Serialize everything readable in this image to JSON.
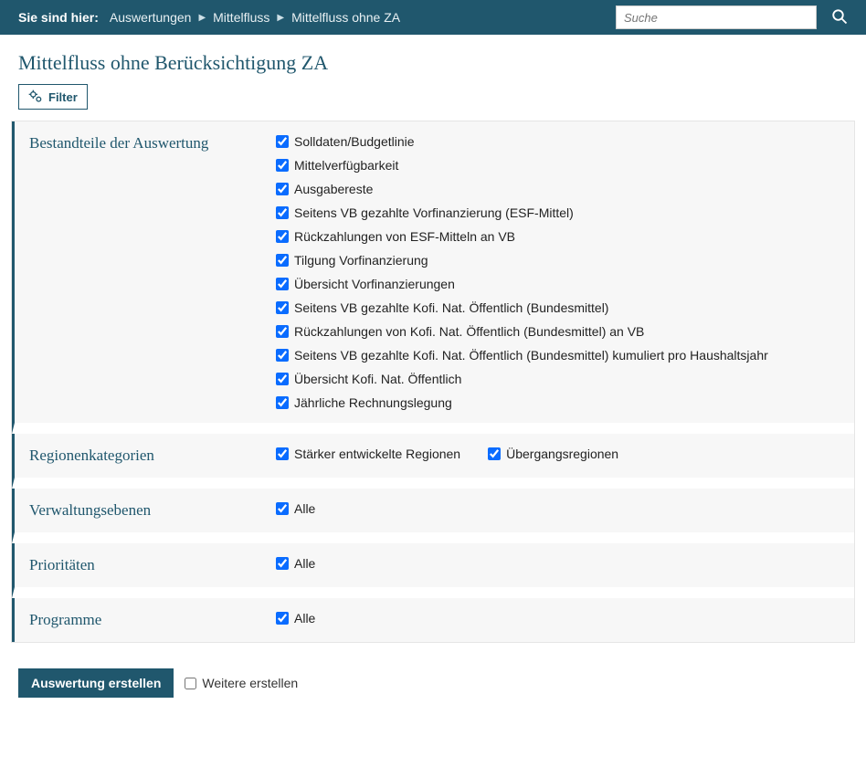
{
  "breadcrumb": {
    "label": "Sie sind hier:",
    "items": [
      "Auswertungen",
      "Mittelfluss",
      "Mittelfluss ohne ZA"
    ]
  },
  "search": {
    "placeholder": "Suche"
  },
  "page_title": "Mittelfluss ohne Berücksichtigung ZA",
  "filter_button": "Filter",
  "sections": {
    "bestandteile": {
      "title": "Bestandteile der Auswertung",
      "items": [
        "Solldaten/Budgetlinie",
        "Mittelverfügbarkeit",
        "Ausgabereste",
        "Seitens VB gezahlte Vorfinanzierung (ESF-Mittel)",
        "Rückzahlungen von ESF-Mitteln an VB",
        "Tilgung Vorfinanzierung",
        "Übersicht Vorfinanzierungen",
        "Seitens VB gezahlte Kofi. Nat. Öffentlich (Bundesmittel)",
        "Rückzahlungen von Kofi. Nat. Öffentlich (Bundesmittel) an VB",
        "Seitens VB gezahlte Kofi. Nat. Öffentlich (Bundesmittel) kumuliert pro Haushaltsjahr",
        "Übersicht Kofi. Nat. Öffentlich",
        "Jährliche Rechnungslegung"
      ]
    },
    "regionen": {
      "title": "Regionenkategorien",
      "items": [
        "Stärker entwickelte Regionen",
        "Übergangsregionen"
      ]
    },
    "verwaltung": {
      "title": "Verwaltungsebenen",
      "items": [
        "Alle"
      ]
    },
    "prioritaeten": {
      "title": "Prioritäten",
      "items": [
        "Alle"
      ]
    },
    "programme": {
      "title": "Programme",
      "items": [
        "Alle"
      ]
    }
  },
  "footer": {
    "create": "Auswertung erstellen",
    "further": "Weitere erstellen"
  }
}
